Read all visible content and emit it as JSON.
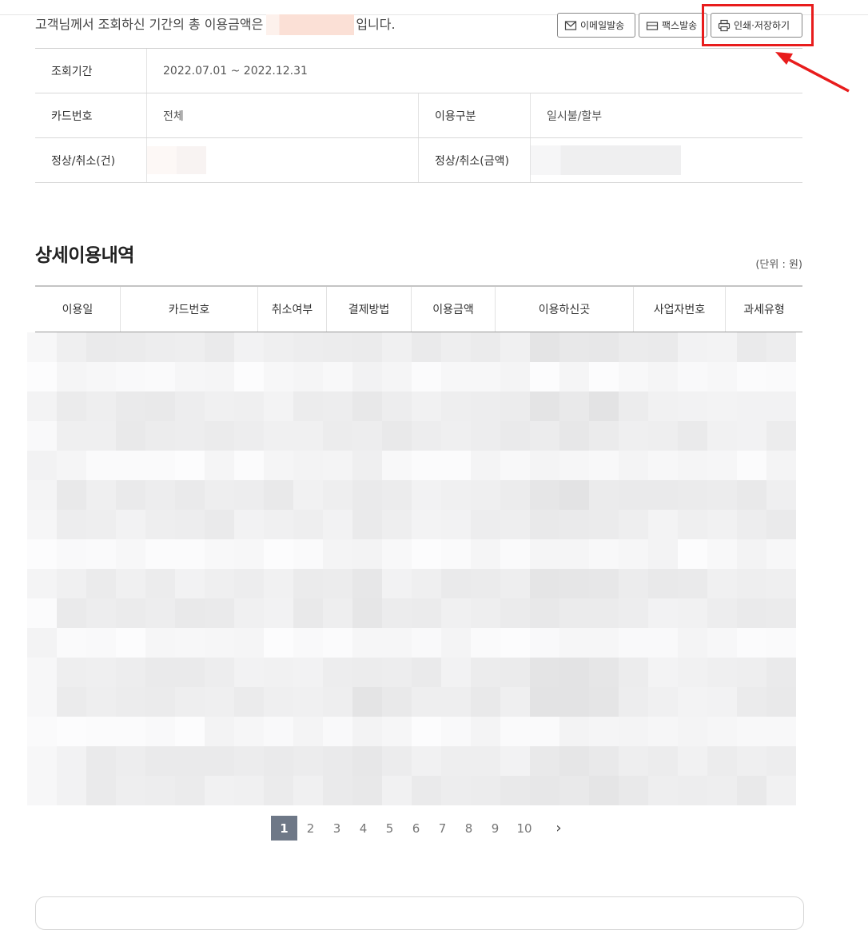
{
  "summary": {
    "prefix": "고객님께서 조회하신 기간의 총 이용금액은",
    "suffix": "입니다."
  },
  "buttons": {
    "email": "이메일발송",
    "fax": "팩스발송",
    "print": "인쇄·저장하기"
  },
  "info": {
    "period_label": "조회기간",
    "period_value": "2022.07.01 ~ 2022.12.31",
    "card_label": "카드번호",
    "card_value": "전체",
    "usage_type_label": "이용구분",
    "usage_type_value": "일시불/할부",
    "count_label": "정상/취소(건)",
    "amount_label": "정상/취소(금액)"
  },
  "detail": {
    "title": "상세이용내역",
    "unit": "(단위 : 원)",
    "columns": [
      "이용일",
      "카드번호",
      "취소여부",
      "결제방법",
      "이용금액",
      "이용하신곳",
      "사업자번호",
      "과세유형"
    ]
  },
  "pagination": {
    "pages": [
      "1",
      "2",
      "3",
      "4",
      "5",
      "6",
      "7",
      "8",
      "9",
      "10"
    ],
    "current": "1",
    "next": "›"
  },
  "colors": {
    "highlight": "#e81c1c",
    "active_page": "#6e7887"
  }
}
